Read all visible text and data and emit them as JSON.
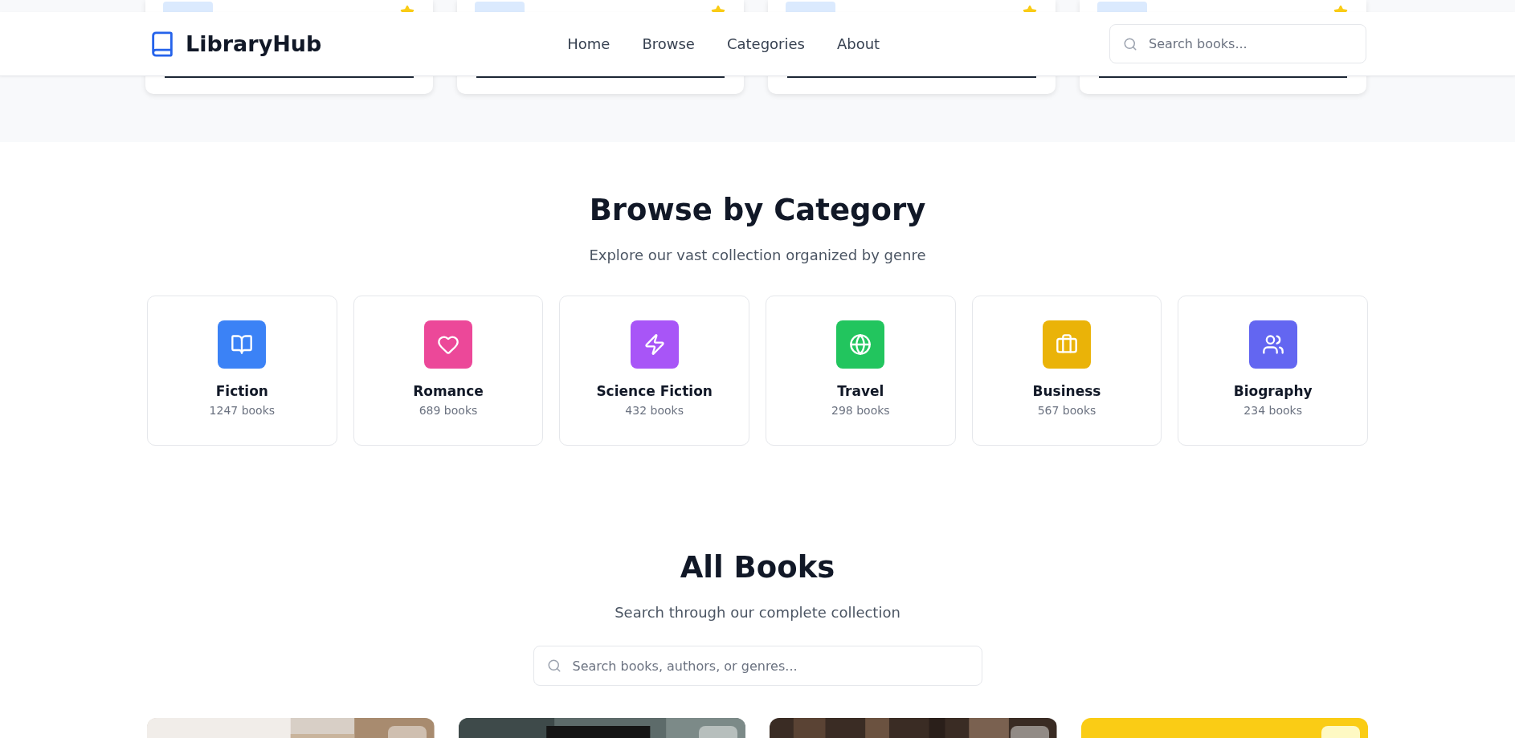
{
  "header": {
    "logo": "LibraryHub",
    "nav": [
      "Home",
      "Browse",
      "Categories",
      "About"
    ],
    "search": {
      "placeholder": "Search books..."
    }
  },
  "featured_books": [
    {
      "kind": "card"
    },
    {
      "kind": "card"
    },
    {
      "kind": "card"
    },
    {
      "kind": "card"
    }
  ],
  "categories_section": {
    "title": "Browse by Category",
    "subtitle": "Explore our vast collection organized by genre",
    "categories": [
      {
        "name": "Fiction",
        "count": "1247 books",
        "color": "#3b82f6"
      },
      {
        "name": "Romance",
        "count": "689 books",
        "color": "#ec4899"
      },
      {
        "name": "Science Fiction",
        "count": "432 books",
        "color": "#a855f7"
      },
      {
        "name": "Travel",
        "count": "298 books",
        "color": "#22c55e"
      },
      {
        "name": "Business",
        "count": "567 books",
        "color": "#eab308"
      },
      {
        "name": "Biography",
        "count": "234 books",
        "color": "#6366f1"
      }
    ]
  },
  "all_books": {
    "title": "All Books",
    "subtitle": "Search through our complete collection",
    "search": {
      "placeholder": "Search books, authors, or genres..."
    },
    "books": [
      {
        "kind": "picture"
      },
      {
        "kind": "picture"
      },
      {
        "kind": "picture"
      },
      {
        "kind": "cover"
      }
    ]
  }
}
